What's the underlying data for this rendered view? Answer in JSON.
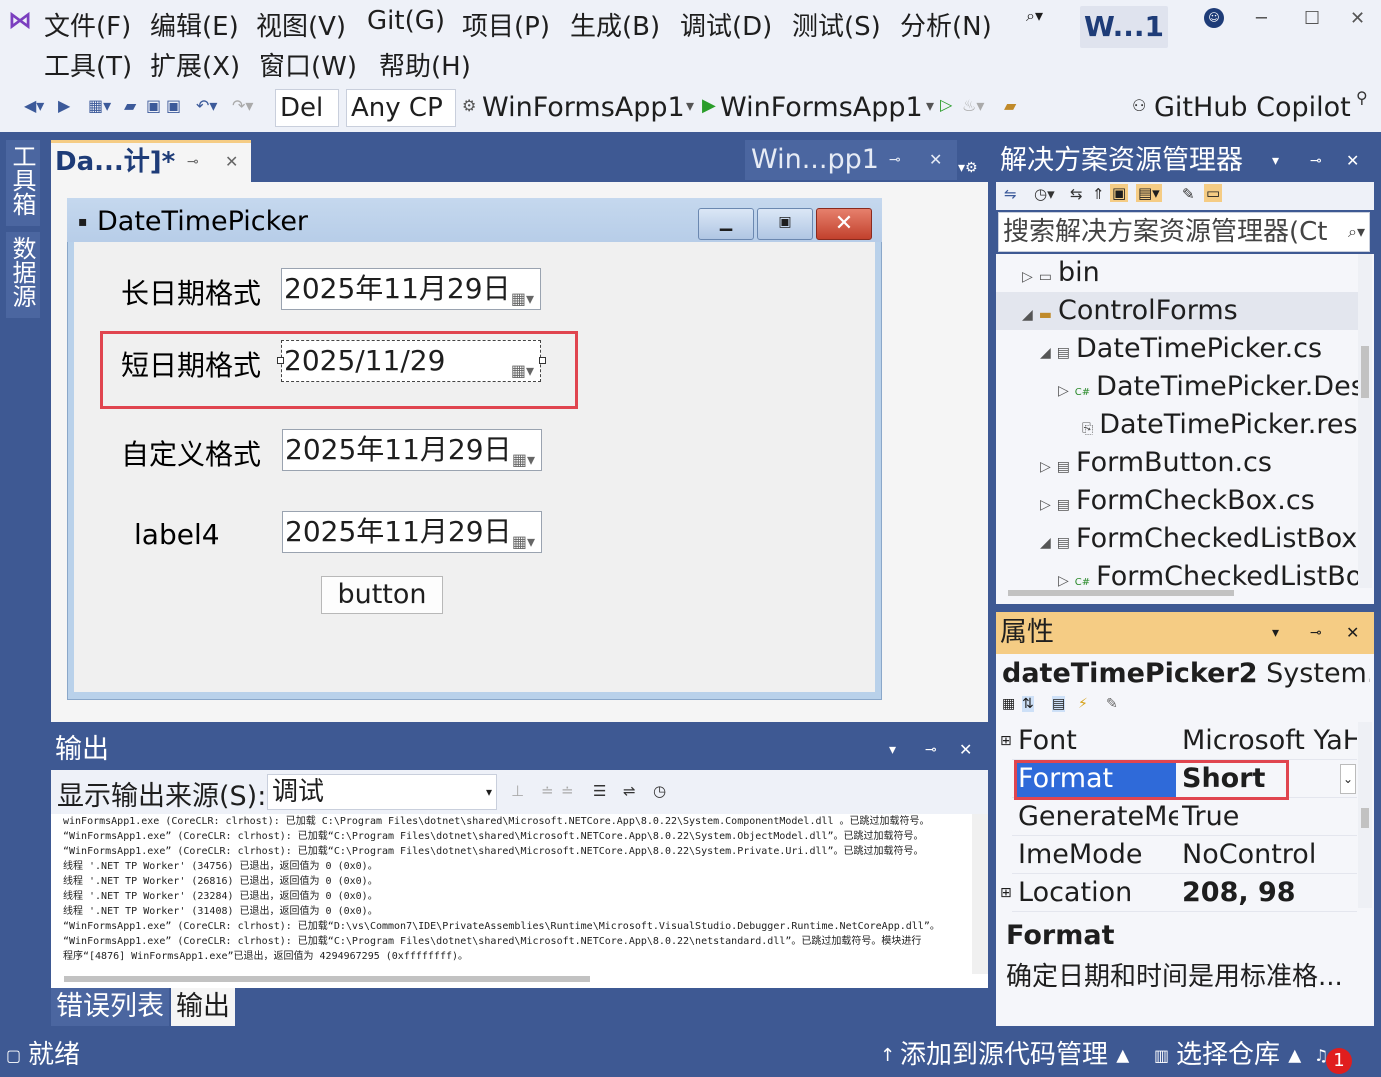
{
  "menu": {
    "row1": [
      "文件(F)",
      "编辑(E)",
      "视图(V)",
      "Git(G)",
      "项目(P)",
      "生成(B)",
      "调试(D)",
      "测试(S)",
      "分析(N)"
    ],
    "row2": [
      "工具(T)",
      "扩展(X)",
      "窗口(W)",
      "帮助(H)"
    ],
    "window_title": "W...1"
  },
  "toolbar": {
    "config": "Del",
    "platform": "Any CP",
    "startup_project": "WinFormsApp1",
    "run_target": "WinFormsApp1",
    "copilot": "GitHub Copilot"
  },
  "left_rail": {
    "toolbox": "工具箱",
    "datasource": "数据源"
  },
  "doc_tabs": {
    "active": "Da...计]*",
    "second": "Win...pp1"
  },
  "form": {
    "title": "DateTimePicker",
    "rows": [
      {
        "label": "长日期格式",
        "value": "2025年11月29日"
      },
      {
        "label": "短日期格式",
        "value": "2025/11/29"
      },
      {
        "label": "自定义格式",
        "value": "2025年11月29日"
      },
      {
        "label": "label4",
        "value": "2025年11月29日"
      }
    ],
    "button": "button",
    "close_glyph": "✕"
  },
  "output": {
    "title": "输出",
    "source_label": "显示输出来源(S):",
    "source_value": "调试",
    "lines": [
      "  winFormsApp1.exe  (CoreCLR: clrhost): 已加载 C:\\Program Files\\dotnet\\shared\\Microsoft.NETCore.App\\8.0.22\\System.ComponentModel.dll 。已跳过加载符号。",
      "“WinFormsApp1.exe” (CoreCLR: clrhost): 已加载“C:\\Program Files\\dotnet\\shared\\Microsoft.NETCore.App\\8.0.22\\System.ObjectModel.dll”。已跳过加载符号。",
      "“WinFormsApp1.exe” (CoreCLR: clrhost): 已加载“C:\\Program Files\\dotnet\\shared\\Microsoft.NETCore.App\\8.0.22\\System.Private.Uri.dll”。已跳过加载符号。",
      "线程 '.NET TP Worker' (34756) 已退出，返回值为 0 (0x0)。",
      "线程 '.NET TP Worker' (26816) 已退出，返回值为 0 (0x0)。",
      "线程 '.NET TP Worker' (23284) 已退出，返回值为 0 (0x0)。",
      "线程 '.NET TP Worker' (31408) 已退出，返回值为 0 (0x0)。",
      "“WinFormsApp1.exe” (CoreCLR: clrhost): 已加载“D:\\vs\\Common7\\IDE\\PrivateAssemblies\\Runtime\\Microsoft.VisualStudio.Debugger.Runtime.NetCoreApp.dll”。",
      "“WinFormsApp1.exe” (CoreCLR: clrhost): 已加载“C:\\Program Files\\dotnet\\shared\\Microsoft.NETCore.App\\8.0.22\\netstandard.dll”。已跳过加载符号。模块进行",
      "程序“[4876] WinFormsApp1.exe”已退出，返回值为 4294967295 (0xffffffff)。"
    ],
    "tabs": [
      "错误列表",
      "输出"
    ]
  },
  "solution_explorer": {
    "title": "解决方案资源管理器",
    "search_placeholder": "搜索解决方案资源管理器(Ct",
    "items": [
      {
        "text": "bin",
        "arrow": "▷",
        "icon": "▭",
        "indent": 0
      },
      {
        "text": "ControlForms",
        "arrow": "◢",
        "icon": "▬",
        "indent": 0
      },
      {
        "text": "DateTimePicker.cs",
        "arrow": "◢",
        "icon": "▤",
        "indent": 1
      },
      {
        "text": "DateTimePicker.Des",
        "arrow": "▷",
        "icon": "C#",
        "indent": 2
      },
      {
        "text": "DateTimePicker.resx",
        "arrow": "",
        "icon": "⎘",
        "indent": 2
      },
      {
        "text": "FormButton.cs",
        "arrow": "▷",
        "icon": "▤",
        "indent": 1
      },
      {
        "text": "FormCheckBox.cs",
        "arrow": "▷",
        "icon": "▤",
        "indent": 1
      },
      {
        "text": "FormCheckedListBox.",
        "arrow": "◢",
        "icon": "▤",
        "indent": 1
      },
      {
        "text": "FormCheckedListBo",
        "arrow": "▷",
        "icon": "C#",
        "indent": 2
      }
    ]
  },
  "properties": {
    "title": "属性",
    "object_name": "dateTimePicker2",
    "object_type": "System.W",
    "rows": [
      {
        "name": "Font",
        "value": "Microsoft YaH",
        "expand": "⊞",
        "bold": false
      },
      {
        "name": "Format",
        "value": "Short",
        "expand": "",
        "bold": true
      },
      {
        "name": "GenerateMe",
        "value": "True",
        "expand": "",
        "bold": false
      },
      {
        "name": "ImeMode",
        "value": "NoControl",
        "expand": "",
        "bold": false
      },
      {
        "name": "Location",
        "value": "208, 98",
        "expand": "⊞",
        "bold": true
      }
    ],
    "desc_title": "Format",
    "desc_text": "确定日期和时间是用标准格..."
  },
  "status": {
    "ready": "就绪",
    "add_source": "添加到源代码管理",
    "select_repo": "选择仓库",
    "notification_count": "1"
  },
  "colors": {
    "frame": "#3e5993",
    "accent_tab": "#f5cc84",
    "selection_red": "#e0454f",
    "prop_selected": "#2f6ad9"
  }
}
